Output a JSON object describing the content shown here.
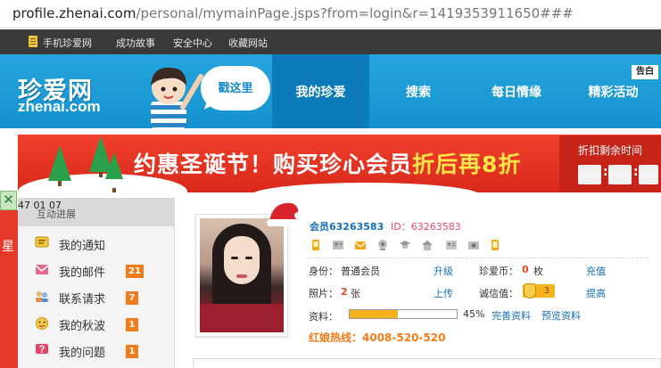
{
  "browser": {
    "url_host": "profile.zhenai.com",
    "url_path": "/personal/mymainPage.jsps?from=login&r=1419353911650###"
  },
  "topbar": {
    "items": [
      "手机珍爱网",
      "成功故事",
      "安全中心",
      "收藏网站"
    ]
  },
  "nav": {
    "logo_cn": "珍爱网",
    "logo_en": "zhenai.com",
    "bubble": "戳这里",
    "tabs": [
      {
        "label": "我的珍爱",
        "active": true
      },
      {
        "label": "搜索",
        "active": false
      },
      {
        "label": "每日情缘",
        "active": false
      },
      {
        "label": "精彩活动",
        "active": false
      }
    ],
    "notice": "告白"
  },
  "banner": {
    "slogan_part1": "约惠圣诞节！购买珍心会员",
    "slogan_part2": "折后再8折",
    "countdown_label": "折扣剩余时间",
    "countdown_colon": ":"
  },
  "left_strip": {
    "close": "✕",
    "label": "星",
    "timestamp": "47 01 07"
  },
  "sidebar": {
    "title": "互动进展",
    "items": [
      {
        "label": "我的通知",
        "badge": "",
        "icon": "notice-icon"
      },
      {
        "label": "我的邮件",
        "badge": "21",
        "icon": "mail-icon"
      },
      {
        "label": "联系请求",
        "badge": "7",
        "icon": "contacts-icon"
      },
      {
        "label": "我的秋波",
        "badge": "1",
        "icon": "wink-icon"
      },
      {
        "label": "我的问题",
        "badge": "1",
        "icon": "question-icon"
      }
    ]
  },
  "profile": {
    "member_name": "会员63263583",
    "member_id": "ID：63263583",
    "status_icons": [
      "phone-icon",
      "contact-card-icon",
      "email-icon",
      "webcam-icon",
      "graduation-cap-icon",
      "house-icon",
      "id-card-icon",
      "camera-icon",
      "mobile-icon"
    ],
    "identity_label": "身份：",
    "identity_value": "普通会员",
    "upgrade_link": "升级",
    "coins_label": "珍爱币：",
    "coins_value": "0",
    "coins_unit": "枚",
    "recharge_link": "充值",
    "photos_label": "照片：",
    "photos_value": "2",
    "photos_unit": "张",
    "upload_link": "上传",
    "credit_label": "诚信值：",
    "credit_value": "3",
    "improve_link": "提高",
    "completeness_label": "资料：",
    "completeness_fraction": 0.45,
    "completeness_text": "45%",
    "complete_link": "完善资料",
    "preview_link": "预览资料",
    "hotline": "红娘热线：4008-520-520"
  },
  "colors": {
    "nav_blue": "#1a9bd7",
    "nav_active": "#0d7bb8",
    "banner_red": "#e0321f",
    "badge_orange": "#f27b1a",
    "link_blue": "#1670b8"
  }
}
